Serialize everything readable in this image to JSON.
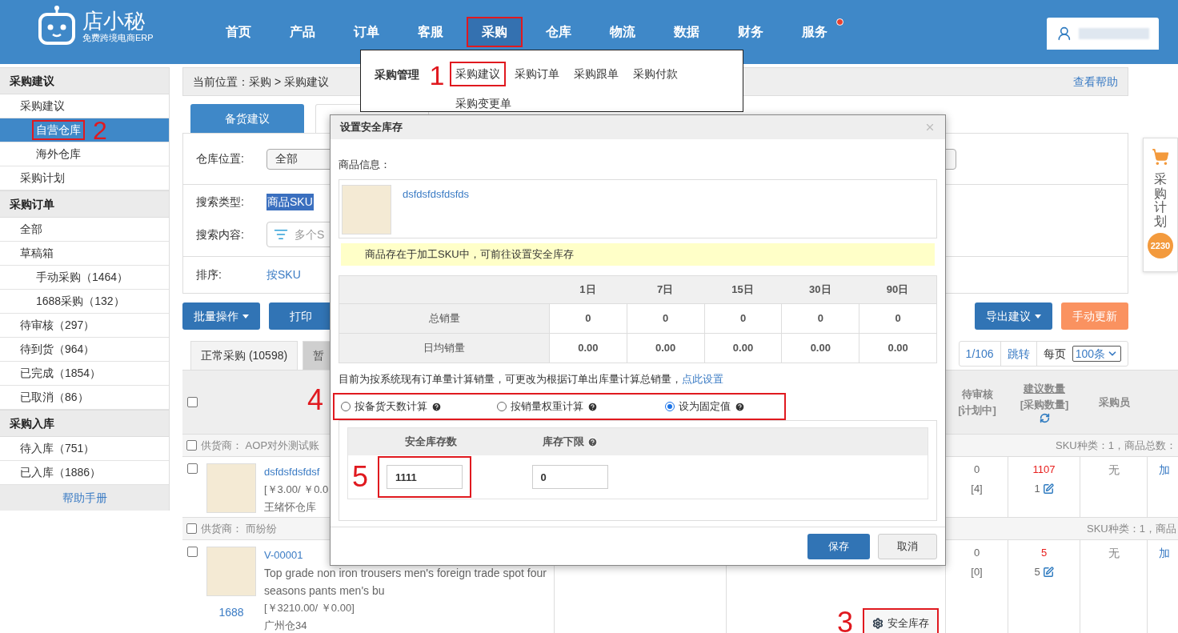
{
  "header": {
    "logo": {
      "name": "店小秘",
      "tagline": "免费跨境电商ERP"
    },
    "nav": [
      {
        "label": "首页",
        "selected": false,
        "highlighted": false,
        "badge": false
      },
      {
        "label": "产品",
        "selected": false,
        "highlighted": false,
        "badge": false
      },
      {
        "label": "订单",
        "selected": false,
        "highlighted": false,
        "badge": false
      },
      {
        "label": "客服",
        "selected": false,
        "highlighted": false,
        "badge": false
      },
      {
        "label": "采购",
        "selected": true,
        "highlighted": true,
        "badge": false
      },
      {
        "label": "仓库",
        "selected": false,
        "highlighted": false,
        "badge": false
      },
      {
        "label": "物流",
        "selected": false,
        "highlighted": false,
        "badge": false
      },
      {
        "label": "数据",
        "selected": false,
        "highlighted": false,
        "badge": false
      },
      {
        "label": "财务",
        "selected": false,
        "highlighted": false,
        "badge": false
      },
      {
        "label": "服务",
        "selected": false,
        "highlighted": false,
        "badge": true
      }
    ]
  },
  "nav_dropdown": {
    "title": "采购管理",
    "annotation": "1",
    "links": [
      {
        "label": "采购建议",
        "highlighted": true
      },
      {
        "label": "采购订单",
        "highlighted": false
      },
      {
        "label": "采购跟单",
        "highlighted": false
      },
      {
        "label": "采购付款",
        "highlighted": false
      },
      {
        "label": "采购变更单",
        "highlighted": false
      }
    ]
  },
  "sidebar": {
    "sections": [
      {
        "title": "采购建议",
        "items": [
          {
            "label": "采购建议",
            "selected": false,
            "highlighted": false,
            "children": [
              {
                "label": "自营仓库",
                "selected": true,
                "highlighted": true,
                "annotation": "2"
              },
              {
                "label": "海外仓库",
                "selected": false,
                "highlighted": false
              }
            ]
          },
          {
            "label": "采购计划",
            "selected": false,
            "highlighted": false
          }
        ]
      },
      {
        "title": "采购订单",
        "items": [
          {
            "label": "全部",
            "selected": false,
            "highlighted": false
          },
          {
            "label": "草稿箱",
            "selected": false,
            "highlighted": false,
            "children": [
              {
                "label": "手动采购（1464）",
                "selected": false,
                "highlighted": false
              },
              {
                "label": "1688采购（132）",
                "selected": false,
                "highlighted": false
              }
            ]
          },
          {
            "label": "待审核（297）",
            "selected": false,
            "highlighted": false
          },
          {
            "label": "待到货（964）",
            "selected": false,
            "highlighted": false
          },
          {
            "label": "已完成（1854）",
            "selected": false,
            "highlighted": false
          },
          {
            "label": "已取消（86）",
            "selected": false,
            "highlighted": false
          }
        ]
      },
      {
        "title": "采购入库",
        "items": [
          {
            "label": "待入库（751）",
            "selected": false,
            "highlighted": false
          },
          {
            "label": "已入库（1886）",
            "selected": false,
            "highlighted": false
          }
        ]
      }
    ],
    "help": "帮助手册"
  },
  "breadcrumb": {
    "text": "当前位置：采购 > 采购建议",
    "help_link": "查看帮助"
  },
  "tabs": [
    {
      "label": "备货建议",
      "selected": true
    },
    {
      "selected": false
    }
  ],
  "filters": {
    "warehouse": {
      "label": "仓库位置:",
      "value": "全部"
    },
    "search_type": {
      "label": "搜索类型:",
      "value": "商品SKU"
    },
    "search_content": {
      "label": "搜索内容:",
      "placeholder": "多个S"
    },
    "sort": {
      "label": "排序:",
      "value": "按SKU"
    }
  },
  "toolbar": {
    "left": [
      {
        "label": "批量操作",
        "dropdown": true
      },
      {
        "label": "打印",
        "dropdown": false
      }
    ],
    "right": [
      {
        "label": "导出建议",
        "kind": "primary",
        "dropdown": true
      },
      {
        "label": "手动更新",
        "kind": "warning",
        "dropdown": false
      }
    ]
  },
  "list_tabs": [
    {
      "label": "正常采购 (10598)",
      "selected": true
    },
    {
      "label": "暂",
      "selected": false
    }
  ],
  "pagination": {
    "page": "1/106",
    "jump": "跳转",
    "per_page_label": "每页",
    "per_page": "100条"
  },
  "table": {
    "select_all_checked": false,
    "annotation": "4",
    "columns": [
      {
        "label": "待审核",
        "sub": "[计划中]"
      },
      {
        "label": "建议数量",
        "sub": "[采购数量]",
        "underlined": true,
        "refresh": true
      },
      {
        "label": "采购员"
      }
    ],
    "groups": [
      {
        "checked": false,
        "supplier": "供货商： AOP对外测试账",
        "summary": "SKU种类：1，商品总数：",
        "products": [
          {
            "checked": false,
            "sku": "dsfdsfdsfdsf",
            "price": "[￥3.00/ ￥0.0",
            "warehouse": "王绪怀仓库",
            "pending": "0",
            "planned": "[4]",
            "suggested": "1107",
            "purchase": "1",
            "buyer": "无",
            "action_1": "加"
          }
        ]
      },
      {
        "checked": false,
        "supplier": "供货商： 而纷纷",
        "summary": "SKU种类：1，商品",
        "products": [
          {
            "checked": false,
            "sku": "V-00001",
            "source": "1688",
            "title": "Top grade non iron trousers men's foreign trade spot four seasons pants men's bu",
            "price": "[￥3210.00/ ￥0.00]",
            "warehouse": "广州仓34",
            "pending": "0",
            "planned": "[0]",
            "suggested": "5",
            "purchase": "5",
            "buyer": "无",
            "action_1": "加",
            "safety_button": {
              "label": "安全库存",
              "highlighted": true,
              "annotation": "3"
            }
          }
        ]
      }
    ]
  },
  "side_panel": {
    "label": "采购计划",
    "count": "2230"
  },
  "modal": {
    "title": "设置安全库存",
    "product_label": "商品信息：",
    "product_link": "dsfdsfdsfdsfds",
    "notice": "商品存在于加工SKU中，可前往设置安全库存",
    "sales_table": {
      "columns": [
        "1日",
        "7日",
        "15日",
        "30日",
        "90日"
      ],
      "rows": [
        {
          "label": "总销量",
          "values": [
            "0",
            "0",
            "0",
            "0",
            "0"
          ]
        },
        {
          "label": "日均销量",
          "values": [
            "0.00",
            "0.00",
            "0.00",
            "0.00",
            "0.00"
          ]
        }
      ]
    },
    "note": {
      "text": "目前为按系统现有订单量计算销量，可更改为根据订单出库量计算总销量，",
      "link": "点此设置"
    },
    "methods_highlighted": true,
    "methods": [
      {
        "label": "按备货天数计算",
        "selected": false
      },
      {
        "label": "按销量权重计算",
        "selected": false
      },
      {
        "label": "设为固定值",
        "selected": true
      }
    ],
    "fixed": {
      "columns": [
        {
          "label": "安全库存数",
          "help": false
        },
        {
          "label": "库存下限",
          "help": true
        }
      ],
      "fields": [
        {
          "value": "1111",
          "highlighted": true,
          "annotation": "5"
        },
        {
          "value": "0"
        }
      ]
    },
    "buttons": [
      {
        "label": "保存",
        "kind": "primary"
      },
      {
        "label": "取消",
        "kind": "default"
      }
    ]
  }
}
